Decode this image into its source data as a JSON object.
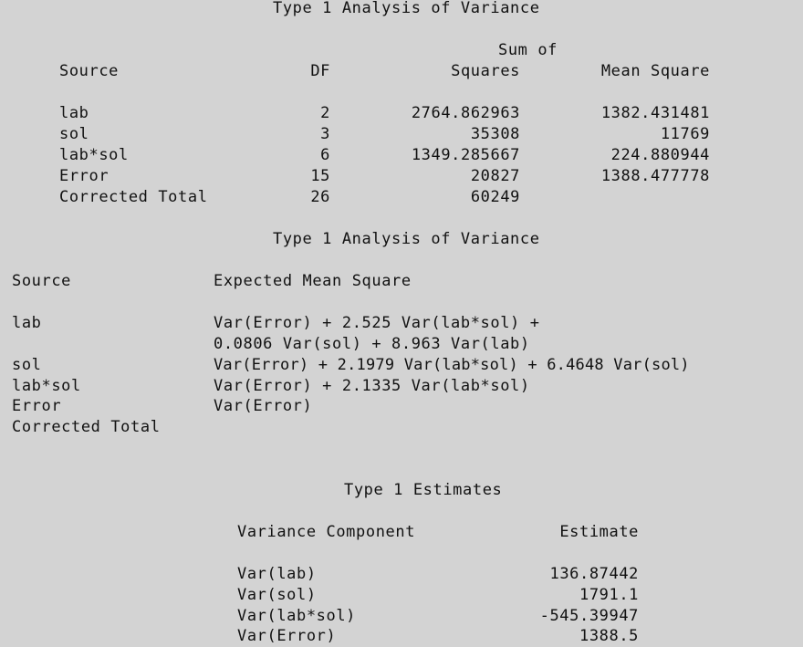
{
  "anova": {
    "title": "Type 1 Analysis of Variance",
    "headers": {
      "source": "Source",
      "df": "DF",
      "ss_line1": "Sum of",
      "ss_line2": "Squares",
      "ms": "Mean Square"
    },
    "rows": [
      {
        "source": "lab",
        "df": "2",
        "ss": "2764.862963",
        "ms": "1382.431481"
      },
      {
        "source": "sol",
        "df": "3",
        "ss": "35308",
        "ms": "11769"
      },
      {
        "source": "lab*sol",
        "df": "6",
        "ss": "1349.285667",
        "ms": "224.880944"
      },
      {
        "source": "Error",
        "df": "15",
        "ss": "20827",
        "ms": "1388.477778"
      },
      {
        "source": "Corrected Total",
        "df": "26",
        "ss": "60249",
        "ms": ""
      }
    ]
  },
  "ems": {
    "title": "Type 1 Analysis of Variance",
    "headers": {
      "source": "Source",
      "ems": "Expected Mean Square"
    },
    "rows": [
      {
        "source": "lab",
        "ems": "Var(Error) + 2.525 Var(lab*sol) +"
      },
      {
        "source": "",
        "ems": "0.0806 Var(sol) + 8.963 Var(lab)"
      },
      {
        "source": "sol",
        "ems": "Var(Error) + 2.1979 Var(lab*sol) + 6.4648 Var(sol)"
      },
      {
        "source": "lab*sol",
        "ems": "Var(Error) + 2.1335 Var(lab*sol)"
      },
      {
        "source": "Error",
        "ems": "Var(Error)"
      },
      {
        "source": "Corrected Total",
        "ems": ""
      }
    ]
  },
  "estimates": {
    "title": "Type 1 Estimates",
    "headers": {
      "component": "Variance Component",
      "estimate": "Estimate"
    },
    "rows": [
      {
        "component": "Var(lab)",
        "estimate": "136.87442"
      },
      {
        "component": "Var(sol)",
        "estimate": "1791.1"
      },
      {
        "component": "Var(lab*sol)",
        "estimate": "-545.39947"
      },
      {
        "component": "Var(Error)",
        "estimate": "1388.5"
      }
    ]
  }
}
